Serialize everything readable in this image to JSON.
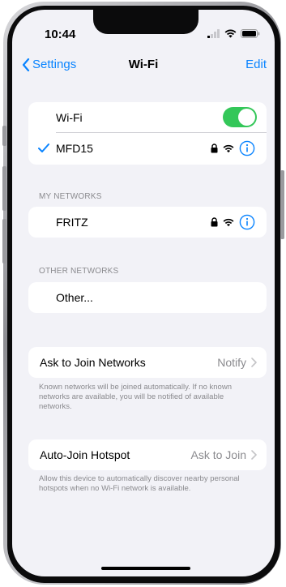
{
  "status_bar": {
    "time": "10:44"
  },
  "nav": {
    "back_label": "Settings",
    "title": "Wi-Fi",
    "edit_label": "Edit"
  },
  "wifi_card": {
    "toggle_label": "Wi-Fi",
    "toggle_on": true,
    "connected_network": "MFD15"
  },
  "my_networks": {
    "header": "MY NETWORKS",
    "networks": [
      "FRITZ"
    ]
  },
  "other_networks": {
    "header": "OTHER NETWORKS",
    "other_label": "Other..."
  },
  "ask_to_join": {
    "label": "Ask to Join Networks",
    "value": "Notify",
    "footer": "Known networks will be joined automatically. If no known networks are available, you will be notified of available networks."
  },
  "auto_join": {
    "label": "Auto-Join Hotspot",
    "value": "Ask to Join",
    "footer": "Allow this device to automatically discover nearby personal hotspots when no Wi-Fi network is available."
  },
  "colors": {
    "accent": "#0a84ff",
    "toggle_on": "#34c759",
    "background": "#f2f2f7"
  }
}
